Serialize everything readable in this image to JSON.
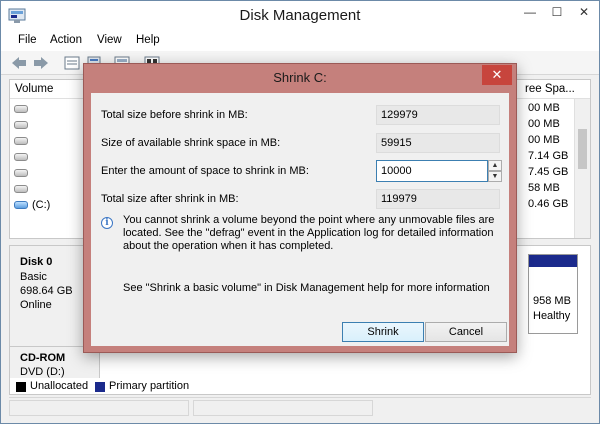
{
  "window": {
    "title": "Disk Management",
    "controls": {
      "minimize": "—",
      "maximize": "☐",
      "close": "✕"
    }
  },
  "menu": [
    "File",
    "Action",
    "View",
    "Help"
  ],
  "volume_list": {
    "columns": {
      "volume": "Volume",
      "free_space": "ree Spa..."
    },
    "rows": [
      {
        "name": "",
        "free": "00 MB"
      },
      {
        "name": "",
        "free": "00 MB"
      },
      {
        "name": "",
        "free": "00 MB"
      },
      {
        "name": "",
        "free": "7.14 GB"
      },
      {
        "name": "",
        "free": "7.45 GB"
      },
      {
        "name": "",
        "free": "58 MB"
      },
      {
        "name": "(C:)",
        "free": "0.46 GB"
      }
    ]
  },
  "disk_pane": {
    "disk0": {
      "name": "Disk 0",
      "type": "Basic",
      "size": "698.64 GB",
      "status": "Online"
    },
    "partition": {
      "size": "958 MB",
      "status": "Healthy"
    },
    "cdrom": {
      "name": "CD-ROM",
      "drive": "DVD (D:)"
    },
    "legend": [
      {
        "label": "Unallocated",
        "color": "#000000"
      },
      {
        "label": "Primary partition",
        "color": "#1b2a8c"
      }
    ]
  },
  "dialog": {
    "title": "Shrink C:",
    "close": "✕",
    "total_before_label": "Total size before shrink in MB:",
    "total_before_value": "129979",
    "available_label": "Size of available shrink space in MB:",
    "available_value": "59915",
    "amount_label": "Enter the amount of space to shrink in MB:",
    "amount_value": "10000",
    "total_after_label": "Total size after shrink in MB:",
    "total_after_value": "119979",
    "info_icon": "info-icon",
    "info_text": "You cannot shrink a volume beyond the point where any unmovable files are located. See the \"defrag\" event in the Application log for detailed information about the operation when it has completed.",
    "help_text": "See \"Shrink a basic volume\" in Disk Management help for more information",
    "shrink_button": "Shrink",
    "cancel_button": "Cancel"
  },
  "colors": {
    "dialog_frame": "#c5807c",
    "close_button": "#c7453d",
    "primary_partition": "#1b2a8c",
    "focus_border": "#3c7fb1"
  }
}
